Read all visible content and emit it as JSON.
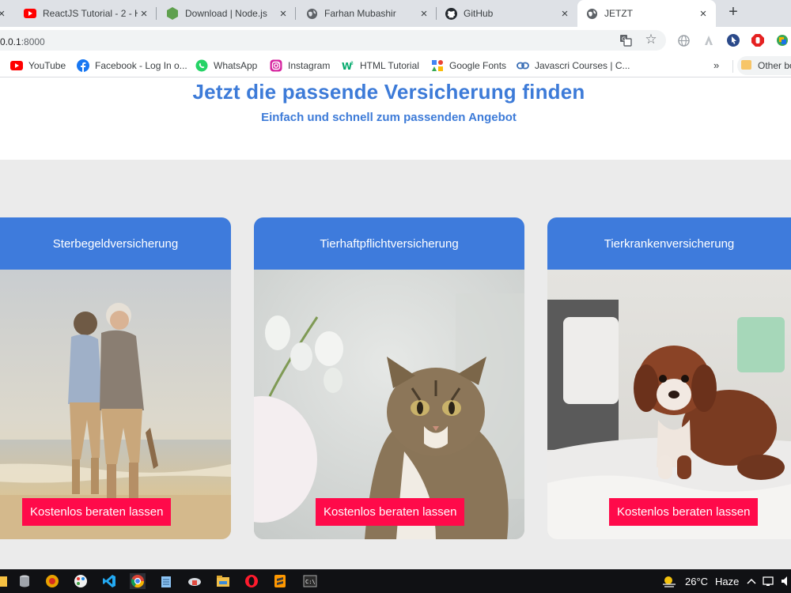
{
  "browser": {
    "tabs": [
      {
        "title": "ReactJS Tutorial - 2 - H",
        "icon": "youtube-icon"
      },
      {
        "title": "Download | Node.js",
        "icon": "nodejs-icon"
      },
      {
        "title": "Farhan Mubashir",
        "icon": "globe-icon"
      },
      {
        "title": "GitHub",
        "icon": "github-icon"
      },
      {
        "title": "JETZT",
        "icon": "globe-icon",
        "active": true
      }
    ],
    "new_tab_label": "+",
    "close_label": "×",
    "address": {
      "host": "0.0.1",
      "port": ":8000"
    },
    "bookmarks": [
      {
        "label": "YouTube",
        "icon": "youtube-icon"
      },
      {
        "label": "Facebook - Log In o...",
        "icon": "facebook-icon"
      },
      {
        "label": "WhatsApp",
        "icon": "whatsapp-icon"
      },
      {
        "label": "Instagram",
        "icon": "instagram-icon"
      },
      {
        "label": "HTML Tutorial",
        "icon": "w3schools-icon"
      },
      {
        "label": "Google Fonts",
        "icon": "google-fonts-icon"
      },
      {
        "label": "Javascri Courses | C...",
        "icon": "link-icon"
      }
    ],
    "bookmarks_more": "»",
    "other_bookmarks": "Other bo"
  },
  "page": {
    "title": "Jetzt die passende Versicherung finden",
    "subtitle": "Einfach und schnell zum passenden Angebot",
    "cards": [
      {
        "title": "Sterbegeldversicherung",
        "button": "Kostenlos beraten lassen",
        "image": "elderly-couple-beach"
      },
      {
        "title": "Tierhaftpflichtversicherung",
        "button": "Kostenlos beraten lassen",
        "image": "cat"
      },
      {
        "title": "Tierkrankenversicherung",
        "button": "Kostenlos beraten lassen",
        "image": "puppy"
      }
    ]
  },
  "taskbar": {
    "temperature": "26°C",
    "weather": "Haze"
  },
  "colors": {
    "accent_blue": "#3e7bdc",
    "cta_red": "#ff0a4a",
    "section_gray": "#ebebeb"
  }
}
